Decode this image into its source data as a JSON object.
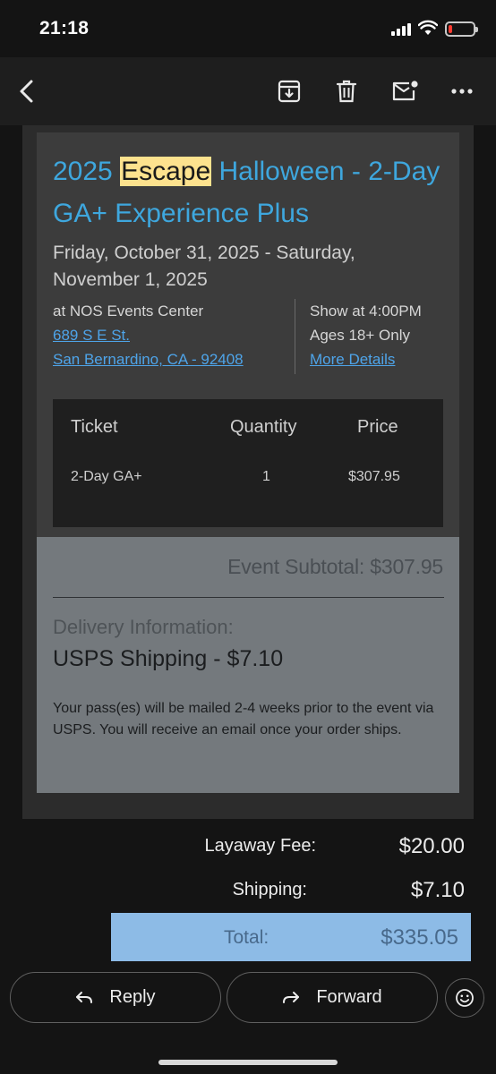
{
  "status_bar": {
    "time": "21:18",
    "battery_level": 0.15,
    "battery_color": "#ff3b30"
  },
  "toolbar": {
    "icons": [
      "back-arrow-icon",
      "archive-icon",
      "trash-icon",
      "mark-unread-icon",
      "more-icon"
    ]
  },
  "event": {
    "title_prefix": "2025 ",
    "title_highlight": "Escape",
    "title_suffix": " Halloween - 2-Day GA+ Experience Plus",
    "dates": "Friday, October 31, 2025 - Saturday, November 1, 2025",
    "venue_line": "at NOS Events Center",
    "address_line1": "689 S E St.",
    "address_line2": "San Bernardino, CA - 92408",
    "show_time": "Show at 4:00PM",
    "ages": "Ages 18+ Only",
    "more_details": "More Details"
  },
  "ticket_table": {
    "headers": [
      "Ticket",
      "Quantity",
      "Price"
    ],
    "rows": [
      {
        "ticket": "2-Day GA+",
        "quantity": "1",
        "price": "$307.95"
      }
    ]
  },
  "summary": {
    "subtotal": "Event Subtotal: $307.95",
    "delivery_heading": "Delivery Information:",
    "delivery_method": "USPS Shipping - $7.10",
    "delivery_note": "Your pass(es) will be mailed 2-4 weeks prior to the event via USPS. You will receive an email once your order ships."
  },
  "totals": {
    "layaway_label": "Layaway Fee:",
    "layaway_value": "$20.00",
    "shipping_label": "Shipping:",
    "shipping_value": "$7.10",
    "total_label": "Total:",
    "total_value": "$335.05"
  },
  "actions": {
    "reply": "Reply",
    "forward": "Forward"
  },
  "colors": {
    "link": "#3ea7de",
    "highlight": "#fde28e",
    "total_bar": "#8dbbe6"
  }
}
